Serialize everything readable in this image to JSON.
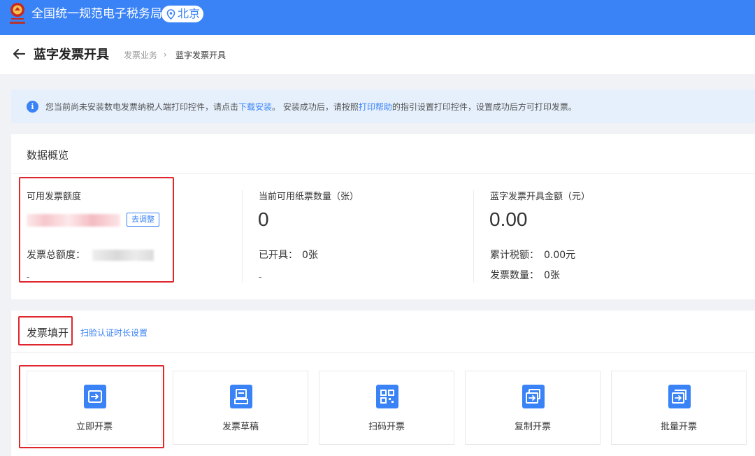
{
  "site": {
    "title": "全国统一规范电子税务局",
    "region": "北京"
  },
  "header": {
    "page_title": "蓝字发票开具",
    "breadcrumb": [
      "发票业务",
      "蓝字发票开具"
    ],
    "breadcrumb_separator": "›"
  },
  "notice": {
    "text_before": "您当前尚未安装数电发票纳税人端打印控件，请点击",
    "download_link": "下载安装",
    "text_middle": "。 安装成功后，请按照",
    "help_link": "打印帮助",
    "text_after": "的指引设置打印控件，设置成功后方可打印发票。"
  },
  "overview": {
    "title": "数据概览",
    "quota": {
      "label": "可用发票额度",
      "adjust_button": "去调整",
      "total_label": "发票总额度：",
      "dash": "-"
    },
    "paper": {
      "label": "当前可用纸票数量（张）",
      "value": "0",
      "issued_label": "已开具：",
      "issued_value": "0张",
      "dash": "-"
    },
    "amount": {
      "label": "蓝字发票开具金额（元）",
      "value": "0.00",
      "tax_label": "累计税额：",
      "tax_value": "0.00元",
      "count_label": "发票数量：",
      "count_value": "0张"
    }
  },
  "fill": {
    "title": "发票填开",
    "face_auth_link": "扫脸认证时长设置",
    "cards": [
      {
        "label": "立即开票",
        "icon": "invoice-issue-icon"
      },
      {
        "label": "发票草稿",
        "icon": "invoice-draft-icon"
      },
      {
        "label": "扫码开票",
        "icon": "qr-code-icon"
      },
      {
        "label": "复制开票",
        "icon": "copy-invoice-icon"
      },
      {
        "label": "批量开票",
        "icon": "batch-invoice-icon"
      }
    ]
  },
  "colors": {
    "brand": "#3a83f7",
    "highlight": "#e0262d",
    "notice_bg": "#e6f0fc"
  }
}
